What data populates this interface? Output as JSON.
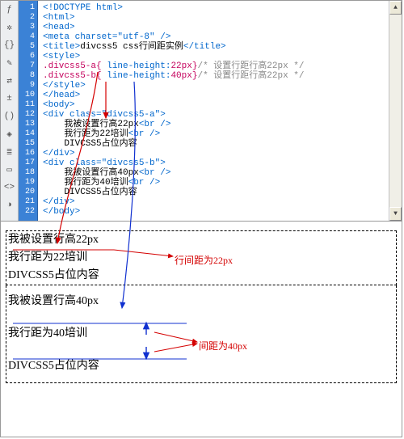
{
  "editor": {
    "line_count": 22,
    "line_numbers": [
      "1",
      "2",
      "3",
      "4",
      "5",
      "6",
      "7",
      "8",
      "9",
      "10",
      "11",
      "12",
      "13",
      "14",
      "15",
      "16",
      "17",
      "18",
      "19",
      "20",
      "21",
      "22"
    ],
    "comment_a": "/* 设置行距行高22px */",
    "comment_b": "/* 设置行距行高22px */",
    "css_rule_a_selector": ".divcss5-a",
    "css_rule_a_prop": "line-height",
    "css_rule_a_val": "22px",
    "css_rule_b_selector": ".divcss5-b",
    "css_rule_b_prop": "line-height",
    "css_rule_b_val": "40px",
    "tag_doctype": "<!DOCTYPE html>",
    "tag_html_open": "<html>",
    "tag_head_open": "<head>",
    "tag_meta": "<meta charset=\"utf-8\" />",
    "title_text": "divcss5 css行间距实例",
    "tag_style_open": "<style>",
    "tag_style_close": "</style>",
    "tag_head_close": "</head>",
    "tag_body_open": "<body>",
    "tag_div_a_open": "<div class=\"divcss5-a\">",
    "body_a_line1": "我被设置行高22px",
    "body_a_line2": "我行距为22培训",
    "body_a_line3": "DIVCSS5占位内容",
    "tag_div_close": "</div>",
    "tag_div_b_open": "<div class=\"divcss5-b\">",
    "body_b_line1": "我被设置行高40px",
    "body_b_line2": "我行距为40培训",
    "body_b_line3": "DIVCSS5占位内容",
    "tag_body_close": "</body>",
    "br_tag": "<br />"
  },
  "toolbar_icons": [
    "fx-icon",
    "gear-icon",
    "braces-icon",
    "wand-icon",
    "arrows-icon",
    "plus-minus-icon",
    "curly-icon",
    "badge-icon",
    "list-icon",
    "screen-icon",
    "tag-icon",
    "palette-icon"
  ],
  "preview": {
    "a1": "我被设置行高22px",
    "a2": "我行距为22培训",
    "a3": "DIVCSS5占位内容",
    "b1": "我被设置行高40px",
    "b2": "我行距为40培训",
    "b3": "DIVCSS5占位内容"
  },
  "annotations": {
    "label_22": "行间距为22px",
    "label_40": "间距为40px"
  }
}
